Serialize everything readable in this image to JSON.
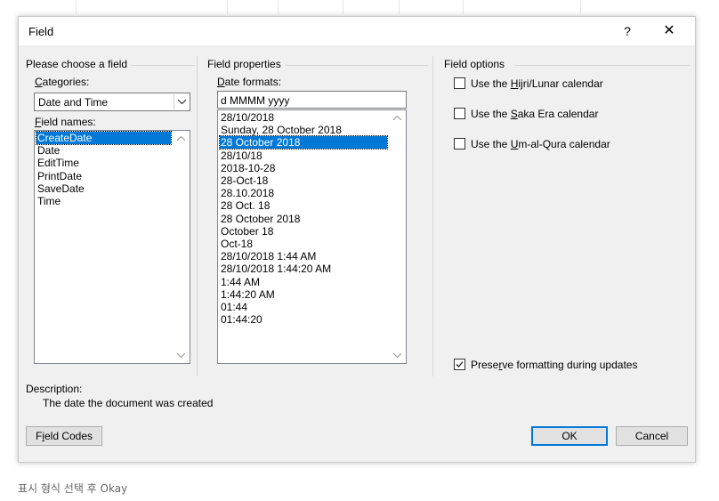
{
  "dialog": {
    "title": "Field",
    "help_symbol": "?",
    "close_symbol": "✕"
  },
  "left_panel": {
    "group_title": "Please choose a field",
    "categories_label": "Categories:",
    "categories_value": "Date and Time",
    "field_names_label": "Field names:",
    "field_names": [
      "CreateDate",
      "Date",
      "EditTime",
      "PrintDate",
      "SaveDate",
      "Time"
    ],
    "selected_field": "CreateDate"
  },
  "middle_panel": {
    "group_title": "Field properties",
    "date_formats_label": "Date formats:",
    "date_format_value": "d MMMM yyyy",
    "date_formats": [
      "28/10/2018",
      "Sunday, 28 October 2018",
      "28 October 2018",
      "28/10/18",
      "2018-10-28",
      "28-Oct-18",
      "28.10.2018",
      "28 Oct. 18",
      "28 October 2018",
      "October 18",
      "Oct-18",
      "28/10/2018 1:44 AM",
      "28/10/2018 1:44:20 AM",
      "1:44 AM",
      "1:44:20 AM",
      "01:44",
      "01:44:20"
    ],
    "selected_format": "28 October 2018"
  },
  "right_panel": {
    "group_title": "Field options",
    "options": [
      {
        "pre": "Use the ",
        "u": "H",
        "post": "ijri/Lunar calendar",
        "checked": false
      },
      {
        "pre": "Use the ",
        "u": "S",
        "post": "aka Era calendar",
        "checked": false
      },
      {
        "pre": "Use the ",
        "u": "U",
        "post": "m-al-Qura calendar",
        "checked": false
      }
    ],
    "preserve": {
      "pre": "Prese",
      "u": "r",
      "post": "ve formatting during updates",
      "checked": true
    }
  },
  "description": {
    "label": "Description:",
    "text": "The date the document was created"
  },
  "buttons": {
    "field_codes": "Field Codes",
    "ok": "OK",
    "cancel": "Cancel"
  },
  "caption": "표시 형식 선택 후 Okay"
}
